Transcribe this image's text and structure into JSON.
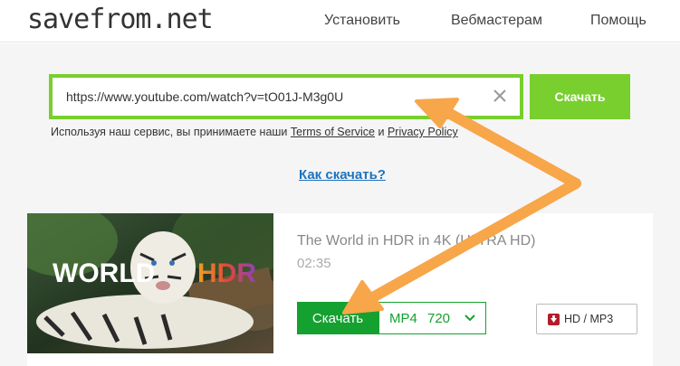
{
  "header": {
    "logo": "savefrom.net",
    "nav": {
      "install": "Установить",
      "webmasters": "Вебмастерам",
      "help": "Помощь"
    }
  },
  "search": {
    "value": "https://www.youtube.com/watch?v=tO01J-M3g0U",
    "download_label": "Скачать",
    "clear_icon": "close-icon"
  },
  "terms": {
    "prefix": "Используя наш сервис, вы принимаете наши",
    "tos": "Terms of Service",
    "and": "и",
    "privacy": "Privacy Policy"
  },
  "how_to": "Как скачать?",
  "result": {
    "thumbnail": {
      "word_left": "WORLD",
      "word_right": "HDR"
    },
    "title": "The World in HDR in 4K (ULTRA HD)",
    "duration": "02:35",
    "download_label": "Скачать",
    "format": "MP4",
    "quality": "720",
    "hd_mp3_label": "HD / MP3"
  },
  "colors": {
    "accent_green": "#78cf2d",
    "download_green": "#15a130",
    "link_blue": "#1e73be",
    "arrow_orange": "#f7a64a"
  }
}
